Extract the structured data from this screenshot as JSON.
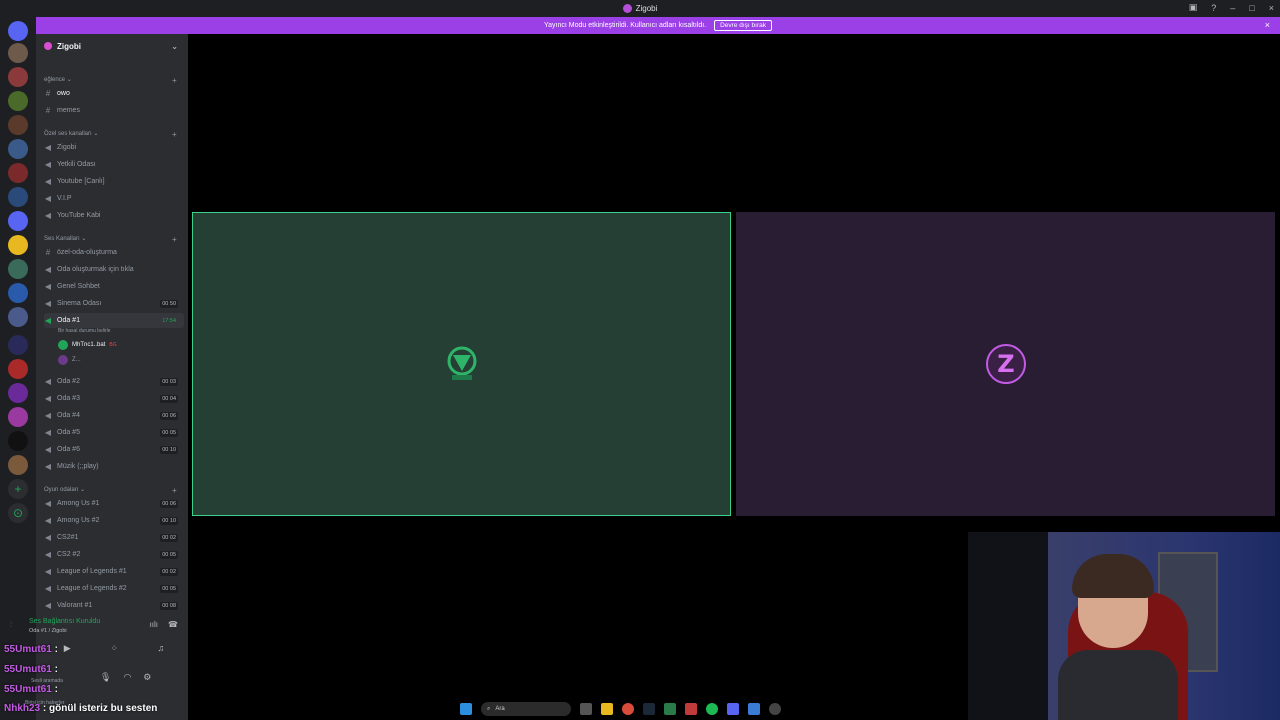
{
  "window": {
    "title": "Zigobi"
  },
  "banner": {
    "text": "Yayıncı Modu etkinleştirildi. Kullanıcı adları kısaltıldı.",
    "button": "Devre dışı bırak"
  },
  "guild": {
    "name": "Zigobi"
  },
  "categories": {
    "eglence": "eğlence",
    "ozel": "Özel ses kanalları",
    "ses": "Ses Kanalları",
    "oyun": "Oyun odaları"
  },
  "channels": {
    "owo": "owo",
    "memes": "memes",
    "zigobi": "Zigobi",
    "yetkili": "Yetkili Odası",
    "youtube": "Youtube [Canlı]",
    "vip": "V.I.P",
    "ytkabi": "YouTube Kabi",
    "ozelOda": "özel-oda-oluşturma",
    "odaTikla": "Oda oluşturmak için tıkla",
    "genel": "Genel Sohbet",
    "sinema": "Sinema Odası",
    "oda1": "Oda #1",
    "oda1sub": "Bir hasal durumu belirle",
    "oda2": "Oda #2",
    "oda3": "Oda #3",
    "oda4": "Oda #4",
    "oda5": "Oda #5",
    "oda6": "Oda #6",
    "muzik": "Müzik (;;play)",
    "among1": "Among Us #1",
    "among2": "Among Us #2",
    "cs1": "CS2#1",
    "cs2": "CS2 #2",
    "lol1": "League of Legends #1",
    "lol2": "League of Legends #2",
    "valo": "Valorant #1"
  },
  "counts": {
    "sinema": "00 50",
    "oda1time": "17:54",
    "oda2": "00 03",
    "oda3": "00 04",
    "oda4": "00 06",
    "oda5": "00 05",
    "oda6": "00 10",
    "among1": "00 06",
    "among2": "00 10",
    "cs1": "00 02",
    "cs2": "00 05",
    "lol1": "00 02",
    "lol2": "00 05",
    "valo": "00 08"
  },
  "members": {
    "m1": "MhTnc1..bat",
    "m1tag": "BG",
    "m2": "Z..."
  },
  "voice": {
    "status": "Ses Bağlantısı Kuruldu",
    "sub": "Oda #1 / Zigobi"
  },
  "user": {
    "sub1": "Sesli aramada",
    "sub2": "Birisi için haberler"
  },
  "chat": [
    {
      "nick": "55Umut61",
      "text": ""
    },
    {
      "nick": "55Umut61",
      "text": ""
    },
    {
      "nick": "55Umut61",
      "text": ""
    },
    {
      "nick": "Nhkh23",
      "text": "gönül isteriz bu sesten"
    }
  ],
  "taskbar": {
    "search": "Ara"
  },
  "tiles": {
    "green_logo": "▽",
    "purple_logo": "Z"
  },
  "colors": {
    "accent": "#9a40e6",
    "green": "#3ad18a"
  }
}
